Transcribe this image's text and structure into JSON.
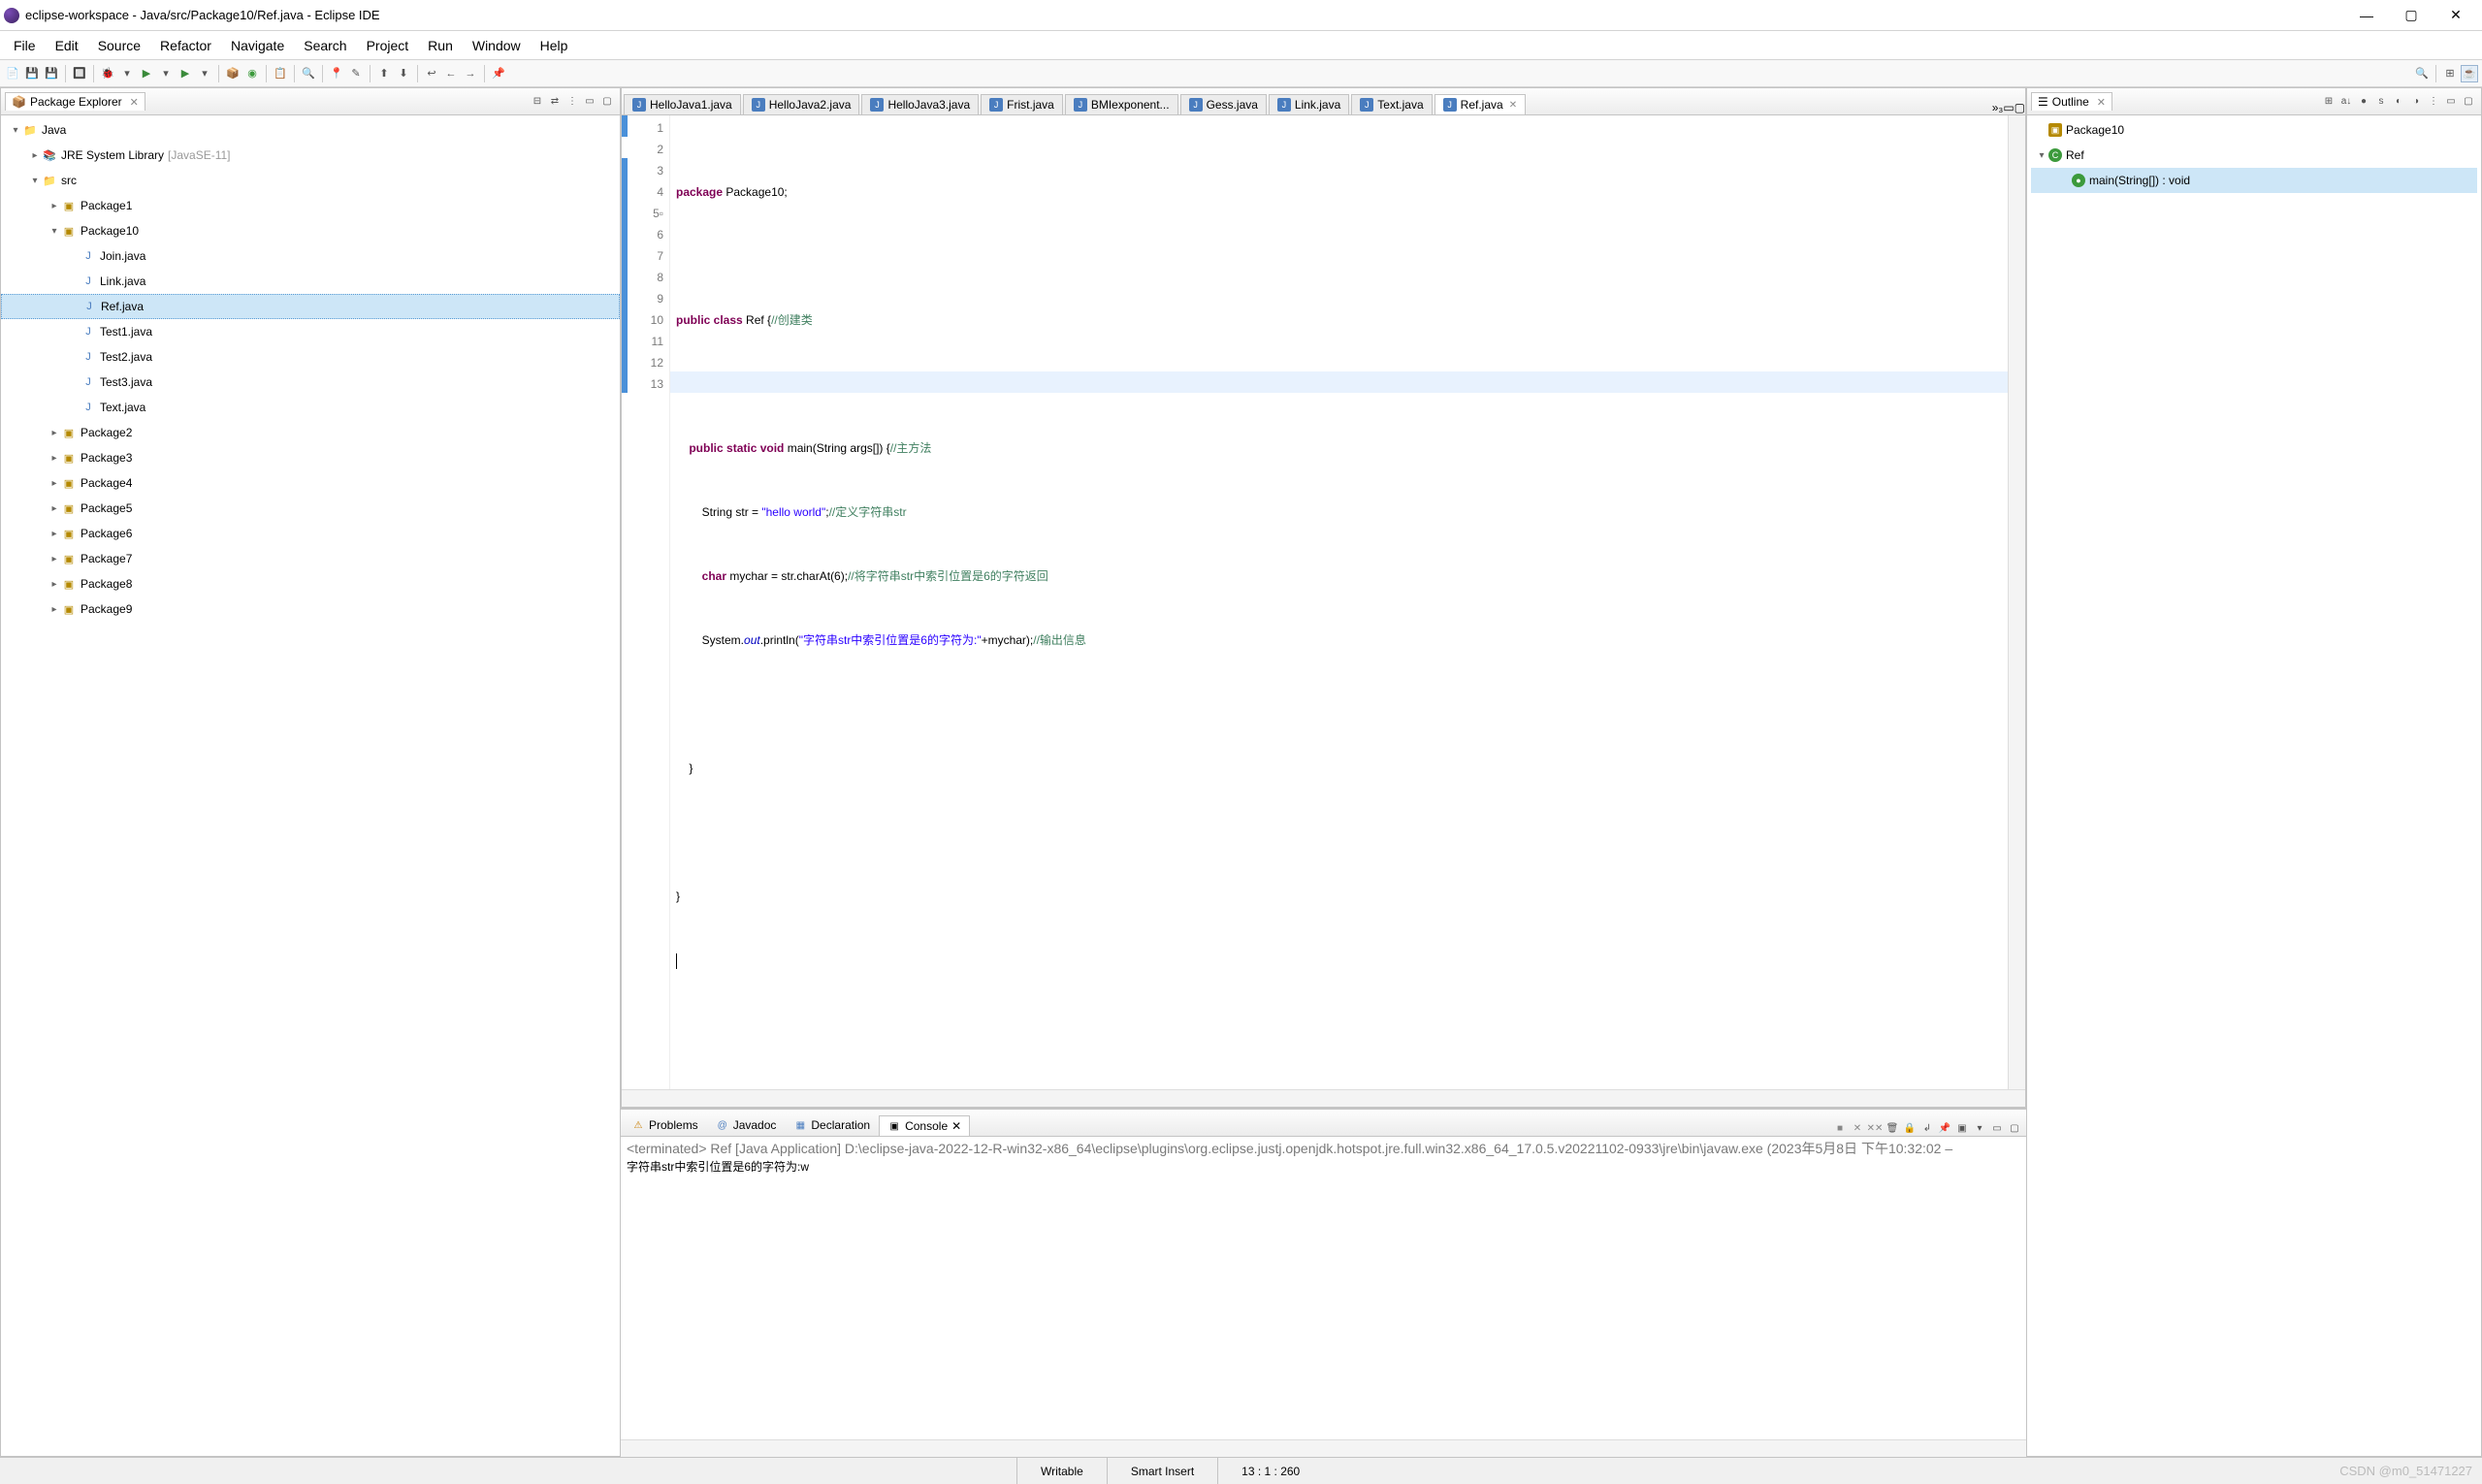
{
  "window": {
    "title": "eclipse-workspace - Java/src/Package10/Ref.java - Eclipse IDE"
  },
  "menu": [
    "File",
    "Edit",
    "Source",
    "Refactor",
    "Navigate",
    "Search",
    "Project",
    "Run",
    "Window",
    "Help"
  ],
  "packageExplorer": {
    "title": "Package Explorer",
    "project": "Java",
    "jre": "JRE System Library",
    "jreExtra": "[JavaSE-11]",
    "srcFolder": "src",
    "packages": [
      "Package1",
      "Package10",
      "Package2",
      "Package3",
      "Package4",
      "Package5",
      "Package6",
      "Package7",
      "Package8",
      "Package9"
    ],
    "p10Files": [
      "Join.java",
      "Link.java",
      "Ref.java",
      "Test1.java",
      "Test2.java",
      "Test3.java",
      "Text.java"
    ],
    "selected": "Ref.java"
  },
  "editor": {
    "tabs": [
      "HelloJava1.java",
      "HelloJava2.java",
      "HelloJava3.java",
      "Frist.java",
      "BMIexponent...",
      "Gess.java",
      "Link.java",
      "Text.java",
      "Ref.java"
    ],
    "activeTab": "Ref.java",
    "moreTabs": "»₃",
    "code": {
      "l1a": "package",
      "l1b": " Package10;",
      "l3a": "public",
      "l3b": " class",
      "l3c": " Ref {",
      "l3d": "//创建类",
      "l5a": "public",
      "l5b": " static",
      "l5c": " void",
      "l5d": " main(String args[]) {",
      "l5e": "//主方法",
      "l6a": "String str = ",
      "l6b": "\"hello world\"",
      "l6c": ";",
      "l6d": "//定义字符串str",
      "l7a": "char",
      "l7b": " mychar = str.charAt(6);",
      "l7c": "//将字符串str中索引位置是6的字符返回",
      "l8a": "System.",
      "l8b": "out",
      "l8c": ".println(",
      "l8d": "\"字符串str中索引位置是6的字符为:\"",
      "l8e": "+mychar);",
      "l8f": "//输出信息",
      "l10": "}",
      "l12": "}"
    }
  },
  "outline": {
    "title": "Outline",
    "items": {
      "pkg": "Package10",
      "cls": "Ref",
      "method": "main(String[]) : void"
    }
  },
  "bottomTabs": [
    "Problems",
    "Javadoc",
    "Declaration",
    "Console"
  ],
  "console": {
    "header": "<terminated> Ref [Java Application] D:\\eclipse-java-2022-12-R-win32-x86_64\\eclipse\\plugins\\org.eclipse.justj.openjdk.hotspot.jre.full.win32.x86_64_17.0.5.v20221102-0933\\jre\\bin\\javaw.exe  (2023年5月8日 下午10:32:02 –",
    "output": "字符串str中索引位置是6的字符为:w"
  },
  "statusbar": {
    "writable": "Writable",
    "insert": "Smart Insert",
    "pos": "13 : 1 : 260",
    "watermark": "CSDN @m0_51471227"
  }
}
